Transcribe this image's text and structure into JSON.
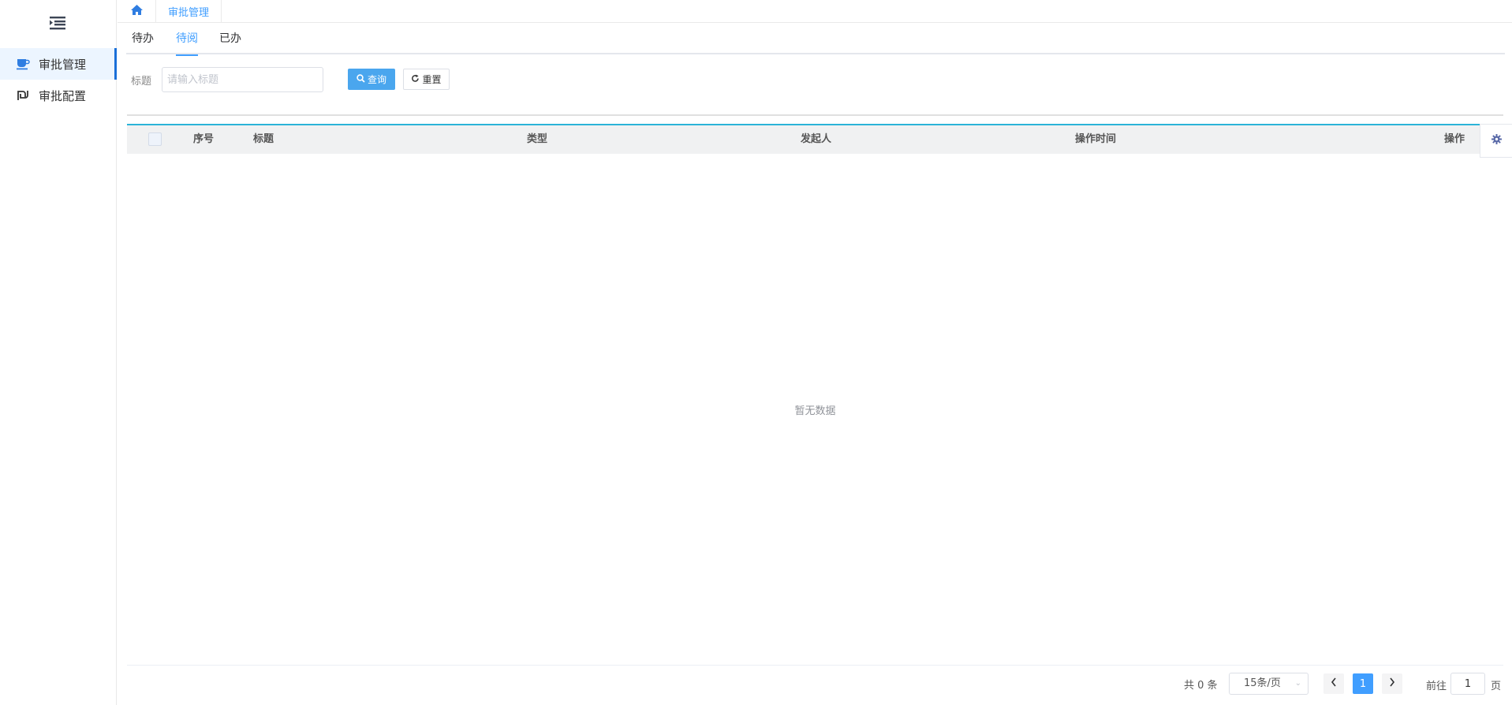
{
  "sidebar": {
    "items": [
      {
        "label": "审批管理",
        "icon": "cup-icon",
        "active": true
      },
      {
        "label": "审批配置",
        "icon": "shekel-icon",
        "active": false
      }
    ]
  },
  "topbar": {
    "home_icon": "home-icon",
    "tab_label": "审批管理"
  },
  "tabs": [
    {
      "label": "待办",
      "active": false
    },
    {
      "label": "待阅",
      "active": true
    },
    {
      "label": "已办",
      "active": false
    }
  ],
  "filter": {
    "title_label": "标题",
    "title_placeholder": "请输入标题",
    "title_value": "",
    "query_label": "查询",
    "reset_label": "重置"
  },
  "table": {
    "columns": [
      "序号",
      "标题",
      "类型",
      "发起人",
      "操作时间",
      "操作"
    ],
    "rows": [],
    "empty_text": "暂无数据"
  },
  "pagination": {
    "total_text": "共 0 条",
    "page_size": "15条/页",
    "current_page": "1",
    "goto_label": "前往",
    "goto_value": "1",
    "goto_suffix": "页"
  },
  "colors": {
    "accent": "#409eff",
    "active_menu_border": "#1a6fd8",
    "table_top_border": "#2bb3d8",
    "query_button": "#4aa6ee"
  }
}
